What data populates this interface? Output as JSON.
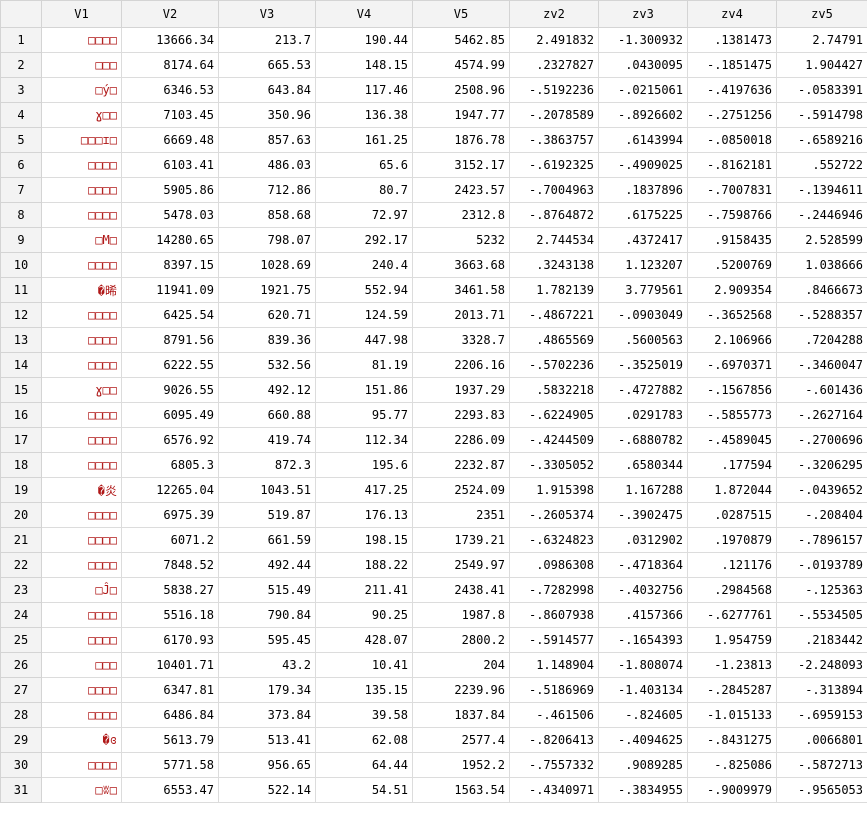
{
  "columns": [
    "V1",
    "V2",
    "V3",
    "V4",
    "V5",
    "zv2",
    "zv3",
    "zv4",
    "zv5"
  ],
  "rows": [
    {
      "n": "1",
      "v1": "□□□□",
      "v2": "13666.34",
      "v3": "213.7",
      "v4": "190.44",
      "v5": "5462.85",
      "zv2": "2.491832",
      "zv3": "-1.300932",
      "zv4": ".1381473",
      "zv5": "2.74791"
    },
    {
      "n": "2",
      "v1": "□□□",
      "v2": "8174.64",
      "v3": "665.53",
      "v4": "148.15",
      "v5": "4574.99",
      "zv2": ".2327827",
      "zv3": ".0430095",
      "zv4": "-.1851475",
      "zv5": "1.904427"
    },
    {
      "n": "3",
      "v1": "□ý□",
      "v2": "6346.53",
      "v3": "643.84",
      "v4": "117.46",
      "v5": "2508.96",
      "zv2": "-.5192236",
      "zv3": "-.0215061",
      "zv4": "-.4197636",
      "zv5": "-.0583391"
    },
    {
      "n": "4",
      "v1": "ɣ□□",
      "v2": "7103.45",
      "v3": "350.96",
      "v4": "136.38",
      "v5": "1947.77",
      "zv2": "-.2078589",
      "zv3": "-.8926602",
      "zv4": "-.2751256",
      "zv5": "-.5914798"
    },
    {
      "n": "5",
      "v1": "□□□ɪ□",
      "v2": "6669.48",
      "v3": "857.63",
      "v4": "161.25",
      "v5": "1876.78",
      "zv2": "-.3863757",
      "zv3": ".6143994",
      "zv4": "-.0850018",
      "zv5": "-.6589216"
    },
    {
      "n": "6",
      "v1": "□□□□",
      "v2": "6103.41",
      "v3": "486.03",
      "v4": "65.6",
      "v5": "3152.17",
      "zv2": "-.6192325",
      "zv3": "-.4909025",
      "zv4": "-.8162181",
      "zv5": ".552722"
    },
    {
      "n": "7",
      "v1": "□□□□",
      "v2": "5905.86",
      "v3": "712.86",
      "v4": "80.7",
      "v5": "2423.57",
      "zv2": "-.7004963",
      "zv3": ".1837896",
      "zv4": "-.7007831",
      "zv5": "-.1394611"
    },
    {
      "n": "8",
      "v1": "□□□□",
      "v2": "5478.03",
      "v3": "858.68",
      "v4": "72.97",
      "v5": "2312.8",
      "zv2": "-.8764872",
      "zv3": ".6175225",
      "zv4": "-.7598766",
      "zv5": "-.2446946"
    },
    {
      "n": "9",
      "v1": "□M□",
      "v2": "14280.65",
      "v3": "798.07",
      "v4": "292.17",
      "v5": "5232",
      "zv2": "2.744534",
      "zv3": ".4372417",
      "zv4": ".9158435",
      "zv5": "2.528599"
    },
    {
      "n": "10",
      "v1": "□□□□",
      "v2": "8397.15",
      "v3": "1028.69",
      "v4": "240.4",
      "v5": "3663.68",
      "zv2": ".3243138",
      "zv3": "1.123207",
      "zv4": ".5200769",
      "zv5": "1.038666"
    },
    {
      "n": "11",
      "v1": "�晞",
      "v2": "11941.09",
      "v3": "1921.75",
      "v4": "552.94",
      "v5": "3461.58",
      "zv2": "1.782139",
      "zv3": "3.779561",
      "zv4": "2.909354",
      "zv5": ".8466673"
    },
    {
      "n": "12",
      "v1": "□□□□",
      "v2": "6425.54",
      "v3": "620.71",
      "v4": "124.59",
      "v5": "2013.71",
      "zv2": "-.4867221",
      "zv3": "-.0903049",
      "zv4": "-.3652568",
      "zv5": "-.5288357"
    },
    {
      "n": "13",
      "v1": "□□□□",
      "v2": "8791.56",
      "v3": "839.36",
      "v4": "447.98",
      "v5": "3328.7",
      "zv2": ".4865569",
      "zv3": ".5600563",
      "zv4": "2.106966",
      "zv5": ".7204288"
    },
    {
      "n": "14",
      "v1": "□□□□",
      "v2": "6222.55",
      "v3": "532.56",
      "v4": "81.19",
      "v5": "2206.16",
      "zv2": "-.5702236",
      "zv3": "-.3525019",
      "zv4": "-.6970371",
      "zv5": "-.3460047"
    },
    {
      "n": "15",
      "v1": "ɣ□□",
      "v2": "9026.55",
      "v3": "492.12",
      "v4": "151.86",
      "v5": "1937.29",
      "zv2": ".5832218",
      "zv3": "-.4727882",
      "zv4": "-.1567856",
      "zv5": "-.601436"
    },
    {
      "n": "16",
      "v1": "□□□□",
      "v2": "6095.49",
      "v3": "660.88",
      "v4": "95.77",
      "v5": "2293.83",
      "zv2": "-.6224905",
      "zv3": ".0291783",
      "zv4": "-.5855773",
      "zv5": "-.2627164"
    },
    {
      "n": "17",
      "v1": "□□□□",
      "v2": "6576.92",
      "v3": "419.74",
      "v4": "112.34",
      "v5": "2286.09",
      "zv2": "-.4244509",
      "zv3": "-.6880782",
      "zv4": "-.4589045",
      "zv5": "-.2700696"
    },
    {
      "n": "18",
      "v1": "□□□□",
      "v2": "6805.3",
      "v3": "872.3",
      "v4": "195.6",
      "v5": "2232.87",
      "zv2": "-.3305052",
      "zv3": ".6580344",
      "zv4": ".177594",
      "zv5": "-.3206295"
    },
    {
      "n": "19",
      "v1": "�炎",
      "v2": "12265.04",
      "v3": "1043.51",
      "v4": "417.25",
      "v5": "2524.09",
      "zv2": "1.915398",
      "zv3": "1.167288",
      "zv4": "1.872044",
      "zv5": "-.0439652"
    },
    {
      "n": "20",
      "v1": "□□□□",
      "v2": "6975.39",
      "v3": "519.87",
      "v4": "176.13",
      "v5": "2351",
      "zv2": "-.2605374",
      "zv3": "-.3902475",
      "zv4": ".0287515",
      "zv5": "-.208404"
    },
    {
      "n": "21",
      "v1": "□□□□",
      "v2": "6071.2",
      "v3": "661.59",
      "v4": "198.15",
      "v5": "1739.21",
      "zv2": "-.6324823",
      "zv3": ".0312902",
      "zv4": ".1970879",
      "zv5": "-.7896157"
    },
    {
      "n": "22",
      "v1": "□□□□",
      "v2": "7848.52",
      "v3": "492.44",
      "v4": "188.22",
      "v5": "2549.97",
      "zv2": ".0986308",
      "zv3": "-.4718364",
      "zv4": ".121176",
      "zv5": "-.0193789"
    },
    {
      "n": "23",
      "v1": "□Ĵ□",
      "v2": "5838.27",
      "v3": "515.49",
      "v4": "211.41",
      "v5": "2438.41",
      "zv2": "-.7282998",
      "zv3": "-.4032756",
      "zv4": ".2984568",
      "zv5": "-.125363"
    },
    {
      "n": "24",
      "v1": "□□□□",
      "v2": "5516.18",
      "v3": "790.84",
      "v4": "90.25",
      "v5": "1987.8",
      "zv2": "-.8607938",
      "zv3": ".4157366",
      "zv4": "-.6277761",
      "zv5": "-.5534505"
    },
    {
      "n": "25",
      "v1": "□□□□",
      "v2": "6170.93",
      "v3": "595.45",
      "v4": "428.07",
      "v5": "2800.2",
      "zv2": "-.5914577",
      "zv3": "-.1654393",
      "zv4": "1.954759",
      "zv5": ".2183442"
    },
    {
      "n": "26",
      "v1": "□□□",
      "v2": "10401.71",
      "v3": "43.2",
      "v4": "10.41",
      "v5": "204",
      "zv2": "1.148904",
      "zv3": "-1.808074",
      "zv4": "-1.23813",
      "zv5": "-2.248093"
    },
    {
      "n": "27",
      "v1": "□□□□",
      "v2": "6347.81",
      "v3": "179.34",
      "v4": "135.15",
      "v5": "2239.96",
      "zv2": "-.5186969",
      "zv3": "-1.403134",
      "zv4": "-.2845287",
      "zv5": "-.313894"
    },
    {
      "n": "28",
      "v1": "□□□□",
      "v2": "6486.84",
      "v3": "373.84",
      "v4": "39.58",
      "v5": "1837.84",
      "zv2": "-.461506",
      "zv3": "-.824605",
      "zv4": "-1.015133",
      "zv5": "-.6959153"
    },
    {
      "n": "29",
      "v1": "�ɞ",
      "v2": "5613.79",
      "v3": "513.41",
      "v4": "62.08",
      "v5": "2577.4",
      "zv2": "-.8206413",
      "zv3": "-.4094625",
      "zv4": "-.8431275",
      "zv5": ".0066801"
    },
    {
      "n": "30",
      "v1": "□□□□",
      "v2": "5771.58",
      "v3": "956.65",
      "v4": "64.44",
      "v5": "1952.2",
      "zv2": "-.7557332",
      "zv3": ".9089285",
      "zv4": "-.825086",
      "zv5": "-.5872713"
    },
    {
      "n": "31",
      "v1": "□ʬ□",
      "v2": "6553.47",
      "v3": "522.14",
      "v4": "54.51",
      "v5": "1563.54",
      "zv2": "-.4340971",
      "zv3": "-.3834955",
      "zv4": "-.9009979",
      "zv5": "-.9565053"
    }
  ],
  "colors": {
    "string_text": "#b01818",
    "header_bg": "#f3f3f3",
    "grid_line": "#dcdcdc"
  }
}
